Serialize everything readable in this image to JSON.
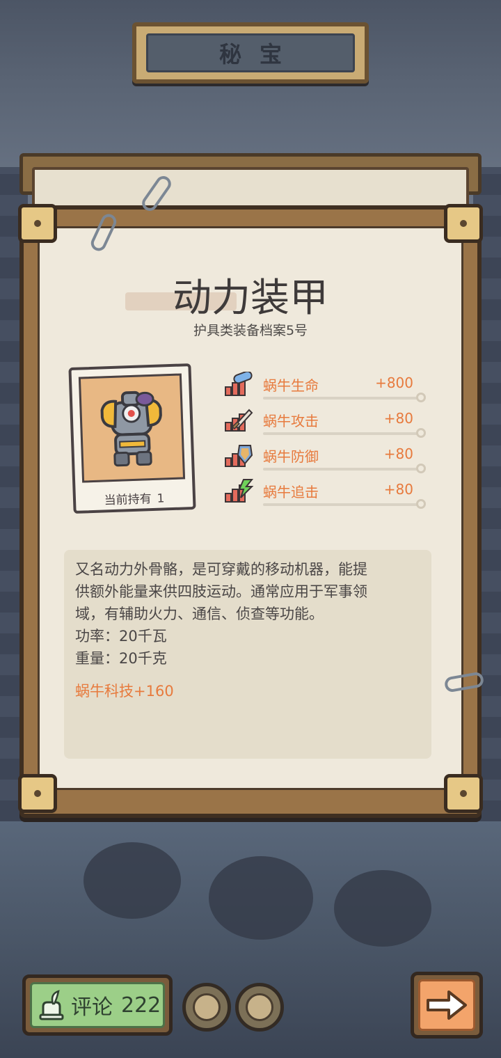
{
  "header": {
    "title": "秘宝"
  },
  "item": {
    "name": "动力装甲",
    "subtitle": "护具类装备档案5号",
    "card": {
      "label": "当前持有",
      "count": "1"
    }
  },
  "stats": [
    {
      "name": "蜗牛生命",
      "value": "+800",
      "icon": "health-pill-icon"
    },
    {
      "name": "蜗牛攻击",
      "value": "+80",
      "icon": "attack-sword-icon"
    },
    {
      "name": "蜗牛防御",
      "value": "+80",
      "icon": "defense-shield-icon"
    },
    {
      "name": "蜗牛追击",
      "value": "+80",
      "icon": "pursuit-lightning-icon"
    }
  ],
  "description": {
    "lines": [
      "又名动力外骨骼，是可穿戴的移动机器，能提",
      "供额外能量来供四肢运动。通常应用于军事领",
      "域，有辅助火力、通信、侦查等功能。",
      "功率：20千瓦",
      "重量：20千克"
    ],
    "tech": "蜗牛科技+160"
  },
  "footer": {
    "comment_label": "评论",
    "comment_count": "222"
  },
  "colors": {
    "accent": "#e77a3d",
    "paper": "#efe9dc",
    "frame": "#9a7448",
    "comment_button": "#9ccf88",
    "next_button": "#f3a46b"
  }
}
